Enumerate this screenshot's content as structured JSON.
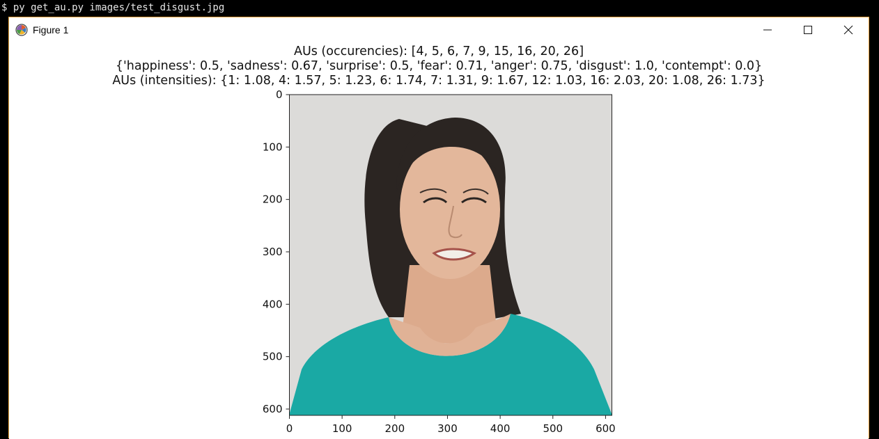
{
  "terminal": {
    "prompt": "$ py get_au.py images/test_disgust.jpg"
  },
  "window": {
    "title": "Figure 1",
    "app_icon": "matplotlib-icon",
    "controls": {
      "minimize_icon": "minimize-icon",
      "maximize_icon": "maximize-icon",
      "close_icon": "close-icon"
    },
    "accent_border_color": "#e8a33d"
  },
  "figure": {
    "title_lines": [
      "AUs (occurencies): [4, 5, 6, 7, 9, 15, 16, 20, 26]",
      "{'happiness': 0.5, 'sadness': 0.67, 'surprise': 0.5, 'fear': 0.71, 'anger': 0.75, 'disgust': 1.0, 'contempt': 0.0}",
      "AUs (intensities): {1: 1.08, 4: 1.57, 5: 1.23, 6: 1.74, 7: 1.31, 9: 1.67, 12: 1.03, 16: 2.03, 20: 1.08, 26: 1.73}"
    ],
    "image_subject": "woman-disgust-face-photo",
    "colors": {
      "background": "#dcdbd9",
      "shirt": "#1aa9a4",
      "skin": "#e3b79b",
      "hair": "#2b2522"
    }
  },
  "chart_data": {
    "type": "image",
    "x_ticks": [
      0,
      100,
      200,
      300,
      400,
      500,
      600
    ],
    "y_ticks": [
      0,
      100,
      200,
      300,
      400,
      500,
      600
    ],
    "xlim": [
      0,
      612
    ],
    "ylim": [
      612,
      0
    ],
    "x_tick_labels": [
      "0",
      "100",
      "200",
      "300",
      "400",
      "500",
      "600"
    ],
    "y_tick_labels": [
      "0",
      "100",
      "200",
      "300",
      "400",
      "500",
      "600"
    ]
  }
}
